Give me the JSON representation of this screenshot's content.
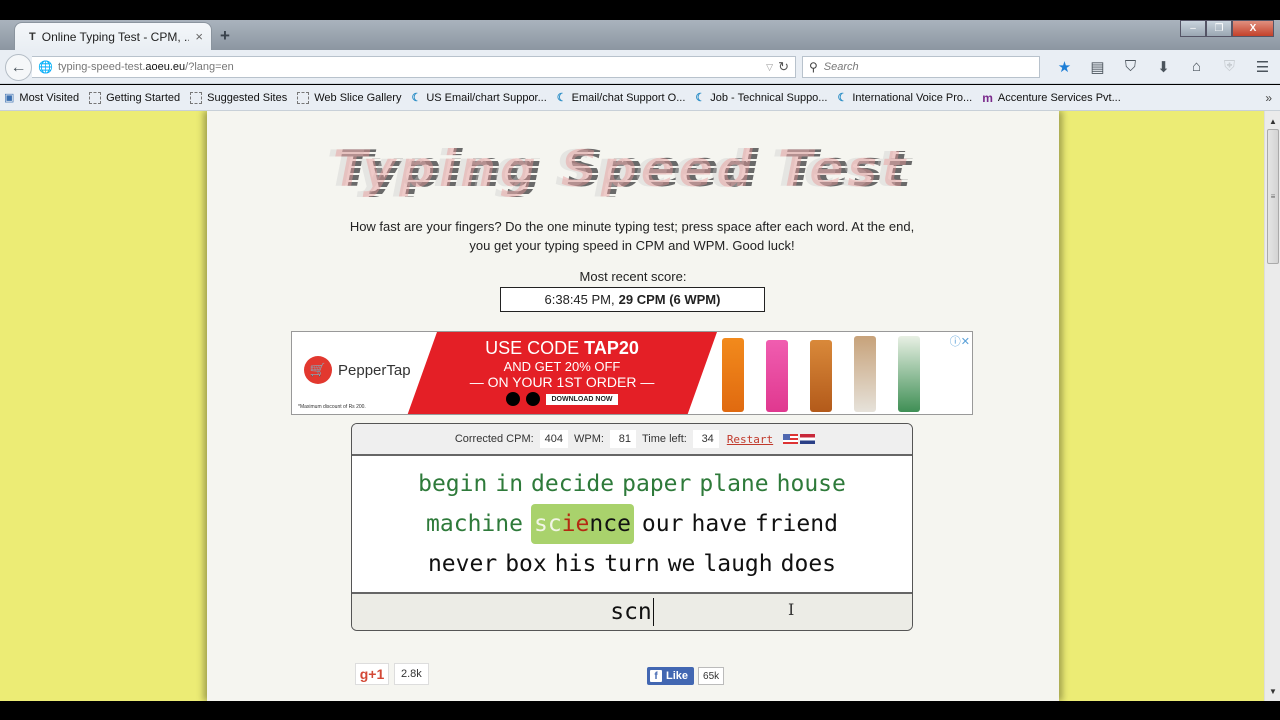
{
  "browser": {
    "tab": {
      "title": "Online Typing Test - CPM, ...",
      "favicon": "T",
      "close": "×"
    },
    "new_tab": "+",
    "window_controls": {
      "minimize": "–",
      "restore": "❐",
      "close": "X"
    },
    "back": "←",
    "url": {
      "prefix": "typing-speed-test.",
      "domain": "aoeu.eu",
      "suffix": "/?lang=en",
      "dropdown": "▽",
      "reload": "C"
    },
    "search": {
      "placeholder": "Search",
      "icon": "🔍"
    },
    "toolbar_icons": [
      "bookmark-star",
      "reading-list",
      "pocket",
      "downloads",
      "home",
      "shield",
      "menu"
    ],
    "bookmarks": [
      {
        "label": "Most Visited",
        "icon": "most-visited"
      },
      {
        "label": "Getting Started",
        "icon": "dashed-box"
      },
      {
        "label": "Suggested Sites",
        "icon": "dashed-box"
      },
      {
        "label": "Web Slice Gallery",
        "icon": "dashed-box"
      },
      {
        "label": "US Email/chart Suppor...",
        "icon": "moon"
      },
      {
        "label": "Email/chat Support O...",
        "icon": "moon"
      },
      {
        "label": "Job - Technical Suppo...",
        "icon": "moon"
      },
      {
        "label": "International Voice Pro...",
        "icon": "moon"
      },
      {
        "label": "Accenture Services Pvt...",
        "icon": "m"
      }
    ],
    "bookmarks_overflow": "»"
  },
  "page": {
    "logo": "Typing Speed Test",
    "intro": "How fast are your fingers? Do the one minute typing test; press space after each word. At the end, you get your typing speed in CPM and WPM. Good luck!",
    "recent_label": "Most recent score:",
    "recent_time": "6:38:45 PM,",
    "recent_score": "29 CPM (6 WPM)",
    "ad": {
      "brand": "PepperTap",
      "line1_pre": "USE CODE ",
      "line1_code": "TAP20",
      "line2": "AND GET 20% OFF",
      "line3": "— ON YOUR 1ST ORDER —",
      "download": "DOWNLOAD NOW",
      "fine_print": "*Maximum discount of Rs 200.",
      "close": "ⓘ✕"
    },
    "test": {
      "corrected_cpm_label": "Corrected CPM:",
      "corrected_cpm": "404",
      "wpm_label": "WPM:",
      "wpm": "81",
      "time_left_label": "Time left:",
      "time_left": "34",
      "restart": "Restart",
      "done_words": [
        "begin",
        "in",
        "decide",
        "paper",
        "plane",
        "house",
        "machine"
      ],
      "current_word": {
        "correct": "sc",
        "wrong": "ie",
        "rest": "nce"
      },
      "upcoming_words": [
        "our",
        "have",
        "friend",
        "never",
        "box",
        "his",
        "turn",
        "we",
        "laugh",
        "does"
      ],
      "input_value": "scn",
      "colors": {
        "done": "#2e7a3a",
        "current_bg": "#a9d26c",
        "error": "#b52a12"
      }
    },
    "social": {
      "gplus_label": "g+1",
      "gplus_count": "2.8k",
      "fb_label": "Like",
      "fb_count": "65k"
    }
  }
}
